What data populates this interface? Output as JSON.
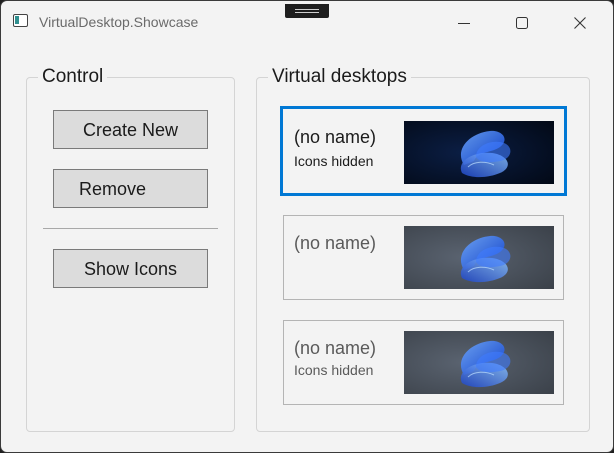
{
  "window": {
    "title": "VirtualDesktop.Showcase",
    "controls": [
      "minimize-icon",
      "maximize-icon",
      "close-icon"
    ]
  },
  "control_group": {
    "title": "Control",
    "create_label": "Create New",
    "remove_label": "Remove",
    "show_icons_label": "Show Icons"
  },
  "desktops_group": {
    "title": "Virtual desktops",
    "items": [
      {
        "name": "(no name)",
        "status": "Icons hidden",
        "selected": true,
        "thumbnail": "bloom-wallpaper-dark"
      },
      {
        "name": "(no name)",
        "status": "",
        "selected": false,
        "thumbnail": "bloom-wallpaper-gray"
      },
      {
        "name": "(no name)",
        "status": "Icons hidden",
        "selected": false,
        "thumbnail": "bloom-wallpaper-gray"
      }
    ]
  },
  "colors": {
    "accent": "#0078d4",
    "window_bg": "#f3f3f3",
    "button_bg": "#dcdcdc"
  }
}
